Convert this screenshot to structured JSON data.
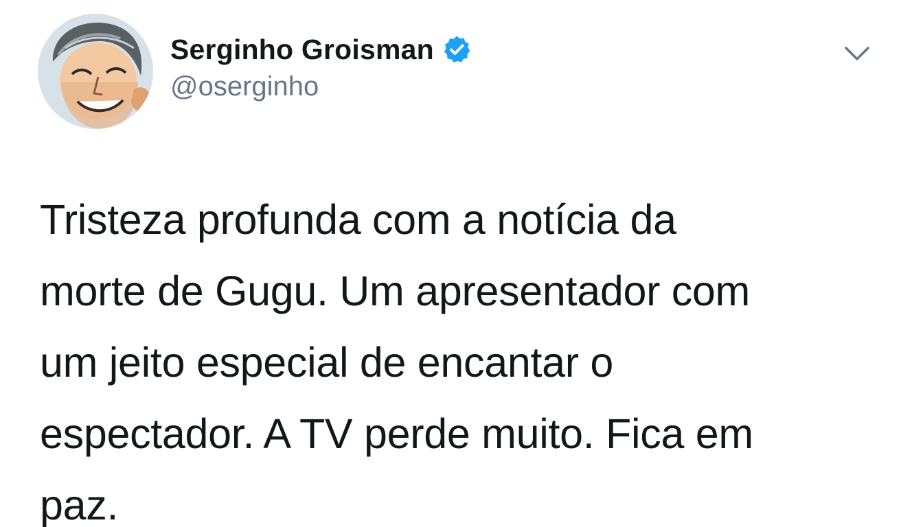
{
  "tweet": {
    "author": {
      "display_name": "Serginho Groisman",
      "handle": "@oserginho",
      "verified": true,
      "avatar_icon": "avatar-caricature"
    },
    "menu_icon": "chevron-down-icon",
    "text_lines": [
      "Tristeza profunda com a notícia da",
      "morte de Gugu. Um apresentador com",
      "um jeito especial de encantar o",
      "espectador. A TV perde muito. Fica em",
      "paz."
    ]
  },
  "colors": {
    "text": "#14171a",
    "secondary_text": "#657786",
    "verified_badge": "#1da1f2",
    "background": "#ffffff"
  }
}
